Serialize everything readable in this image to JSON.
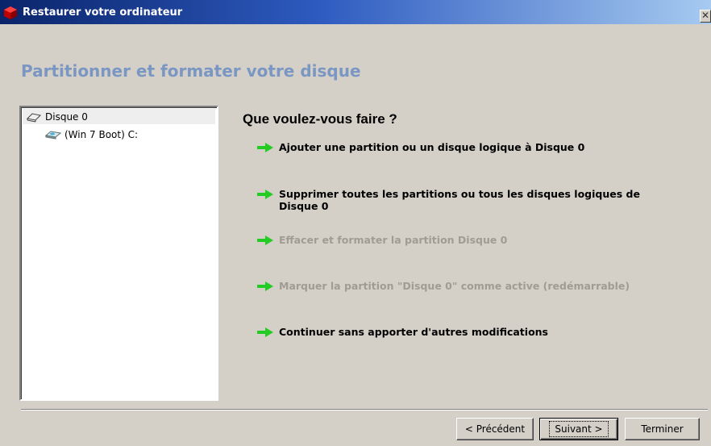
{
  "window": {
    "title": "Restaurer votre ordinateur",
    "close_glyph": "✕",
    "icon": "red-cube-app-icon"
  },
  "header": {
    "title": "Partitionner et formater votre disque",
    "title_color": "#7a96c2"
  },
  "tree": {
    "items": [
      {
        "label": "Disque 0",
        "icon": "disk-icon",
        "selected": true
      },
      {
        "label": "(Win 7 Boot) C:",
        "icon": "partition-icon",
        "selected": false
      }
    ]
  },
  "main": {
    "question": "Que voulez-vous faire ?",
    "options": [
      {
        "label": "Ajouter une partition ou un disque logique à Disque 0",
        "enabled": true
      },
      {
        "label": "Supprimer toutes les partitions ou tous les disques logiques de Disque 0",
        "enabled": true
      },
      {
        "label": "Effacer et formater la partition Disque 0",
        "enabled": false
      },
      {
        "label": "Marquer la partition \"Disque 0\" comme active (redémarrable)",
        "enabled": false
      },
      {
        "label": "Continuer sans apporter d'autres modifications",
        "enabled": true
      }
    ],
    "arrow_color": "#22cc22"
  },
  "footer": {
    "previous_label": "< Précédent",
    "next_label": "Suivant >",
    "finish_label": "Terminer"
  }
}
